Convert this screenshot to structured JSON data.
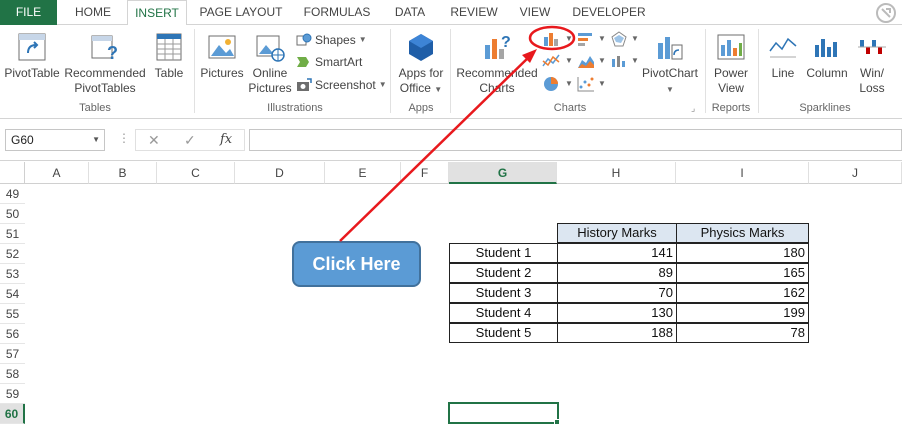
{
  "tabs": {
    "file": "FILE",
    "home": "HOME",
    "insert": "INSERT",
    "page_layout": "PAGE LAYOUT",
    "formulas": "FORMULAS",
    "data": "DATA",
    "review": "REVIEW",
    "view": "VIEW",
    "developer": "DEVELOPER"
  },
  "ribbon": {
    "tables": {
      "label": "Tables",
      "pivottable": "PivotTable",
      "recommended_pivot_1": "Recommended",
      "recommended_pivot_2": "PivotTables",
      "table": "Table"
    },
    "illustrations": {
      "label": "Illustrations",
      "pictures": "Pictures",
      "online_1": "Online",
      "online_2": "Pictures",
      "shapes": "Shapes",
      "smartart": "SmartArt",
      "screenshot": "Screenshot"
    },
    "apps": {
      "label": "Apps",
      "apps_1": "Apps for",
      "apps_2": "Office"
    },
    "charts": {
      "label": "Charts",
      "recommended_1": "Recommended",
      "recommended_2": "Charts",
      "pivotchart": "PivotChart"
    },
    "reports": {
      "label": "Reports",
      "power_1": "Power",
      "power_2": "View"
    },
    "sparklines": {
      "label": "Sparklines",
      "line": "Line",
      "column": "Column",
      "winloss_1": "Win/",
      "winloss_2": "Loss"
    }
  },
  "formula_bar": {
    "name_box": "G60",
    "fx": "fx",
    "cancel": "✕",
    "enter": "✓",
    "formula": ""
  },
  "columns": [
    "A",
    "B",
    "C",
    "D",
    "E",
    "F",
    "G",
    "H",
    "I",
    "J"
  ],
  "rows": [
    "49",
    "50",
    "51",
    "52",
    "53",
    "54",
    "55",
    "56",
    "57",
    "58",
    "59",
    "60"
  ],
  "table": {
    "headers": [
      "History Marks",
      "Physics Marks"
    ],
    "rows": [
      {
        "student": "Student 1",
        "history": "141",
        "physics": "180"
      },
      {
        "student": "Student 2",
        "history": "89",
        "physics": "165"
      },
      {
        "student": "Student 3",
        "history": "70",
        "physics": "162"
      },
      {
        "student": "Student 4",
        "history": "130",
        "physics": "199"
      },
      {
        "student": "Student 5",
        "history": "188",
        "physics": "78"
      }
    ]
  },
  "callout": "Click Here",
  "colors": {
    "excel_green": "#217346",
    "header_fill": "#dce6f1",
    "callout_fill": "#5b9bd5",
    "arrow_red": "#e8191d"
  }
}
